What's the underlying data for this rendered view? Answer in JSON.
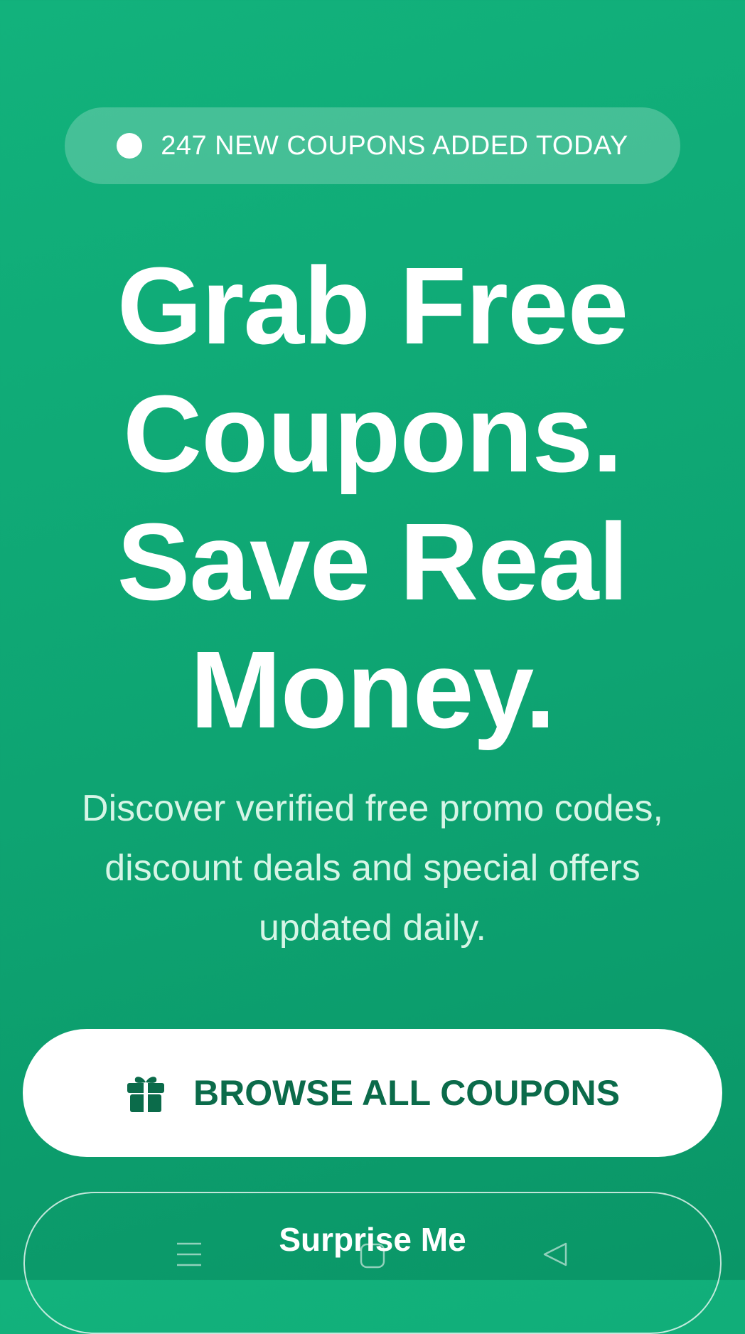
{
  "badge": {
    "text": "247 NEW COUPONS ADDED TODAY"
  },
  "hero": {
    "headline_lines": [
      "Grab Free",
      "Coupons.",
      "Save Real",
      "Money."
    ],
    "subtext_lines": [
      "Discover verified free promo codes,",
      "discount deals and special offers",
      "updated daily."
    ]
  },
  "buttons": {
    "primary_label": "BROWSE ALL COUPONS",
    "primary_icon": "gift-icon",
    "secondary_label": "Surprise Me"
  },
  "system_nav": {
    "icons": [
      "menu-icon",
      "home-icon",
      "back-icon"
    ]
  },
  "colors": {
    "background": "#10aa76",
    "primary_text": "#0b6b4a",
    "subtext": "#d6f5e6"
  }
}
